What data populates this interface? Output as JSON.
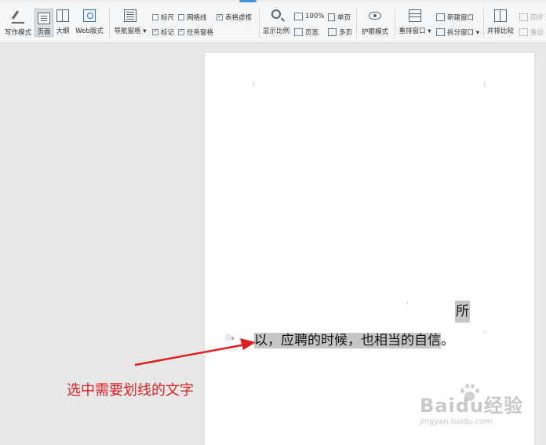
{
  "ribbon": {
    "view_modes": [
      {
        "label": "写作模式",
        "icon": "pencil-icon"
      },
      {
        "label": "页面",
        "icon": "page-view-icon"
      },
      {
        "label": "大纲",
        "icon": "outline-icon"
      },
      {
        "label": "Web版式",
        "icon": "web-layout-icon"
      }
    ],
    "nav_pane": {
      "label": "导航窗格",
      "icon": "navigation-pane-icon"
    },
    "checkboxes": [
      {
        "label": "标尺",
        "checked": false
      },
      {
        "label": "网格线",
        "checked": false
      },
      {
        "label": "表格虚框",
        "checked": true
      },
      {
        "label": "标记",
        "checked": true
      },
      {
        "label": "任务窗格",
        "checked": true
      }
    ],
    "zoom": {
      "label": "显示比例",
      "percent_label": "100%",
      "page_width_label": "页宽"
    },
    "page_view": {
      "single_label": "单页",
      "multi_label": "多页"
    },
    "eye_care": {
      "label": "护眼模式"
    },
    "arrange": {
      "label": "重排窗口"
    },
    "new_window": {
      "label": "新建窗口"
    },
    "split_window": {
      "label": "拆分窗口"
    },
    "side_by_side": {
      "label": "并排比较"
    },
    "sync_scroll": {
      "label": "同步"
    },
    "reset_position": {
      "label": "重设"
    }
  },
  "document": {
    "line1": "所",
    "line2_selected": "以，应聘的时候，也相当的自信",
    "line2_tail": "。"
  },
  "annotation": {
    "text": "选中需要划线的文字",
    "color": "#e02020"
  },
  "watermark": {
    "brand": "Baidu经验",
    "url": "jingyan.baidu.com"
  },
  "colors": {
    "accent": "#4a90e2",
    "selection": "#c6c6c6",
    "arrow": "#e02020"
  }
}
